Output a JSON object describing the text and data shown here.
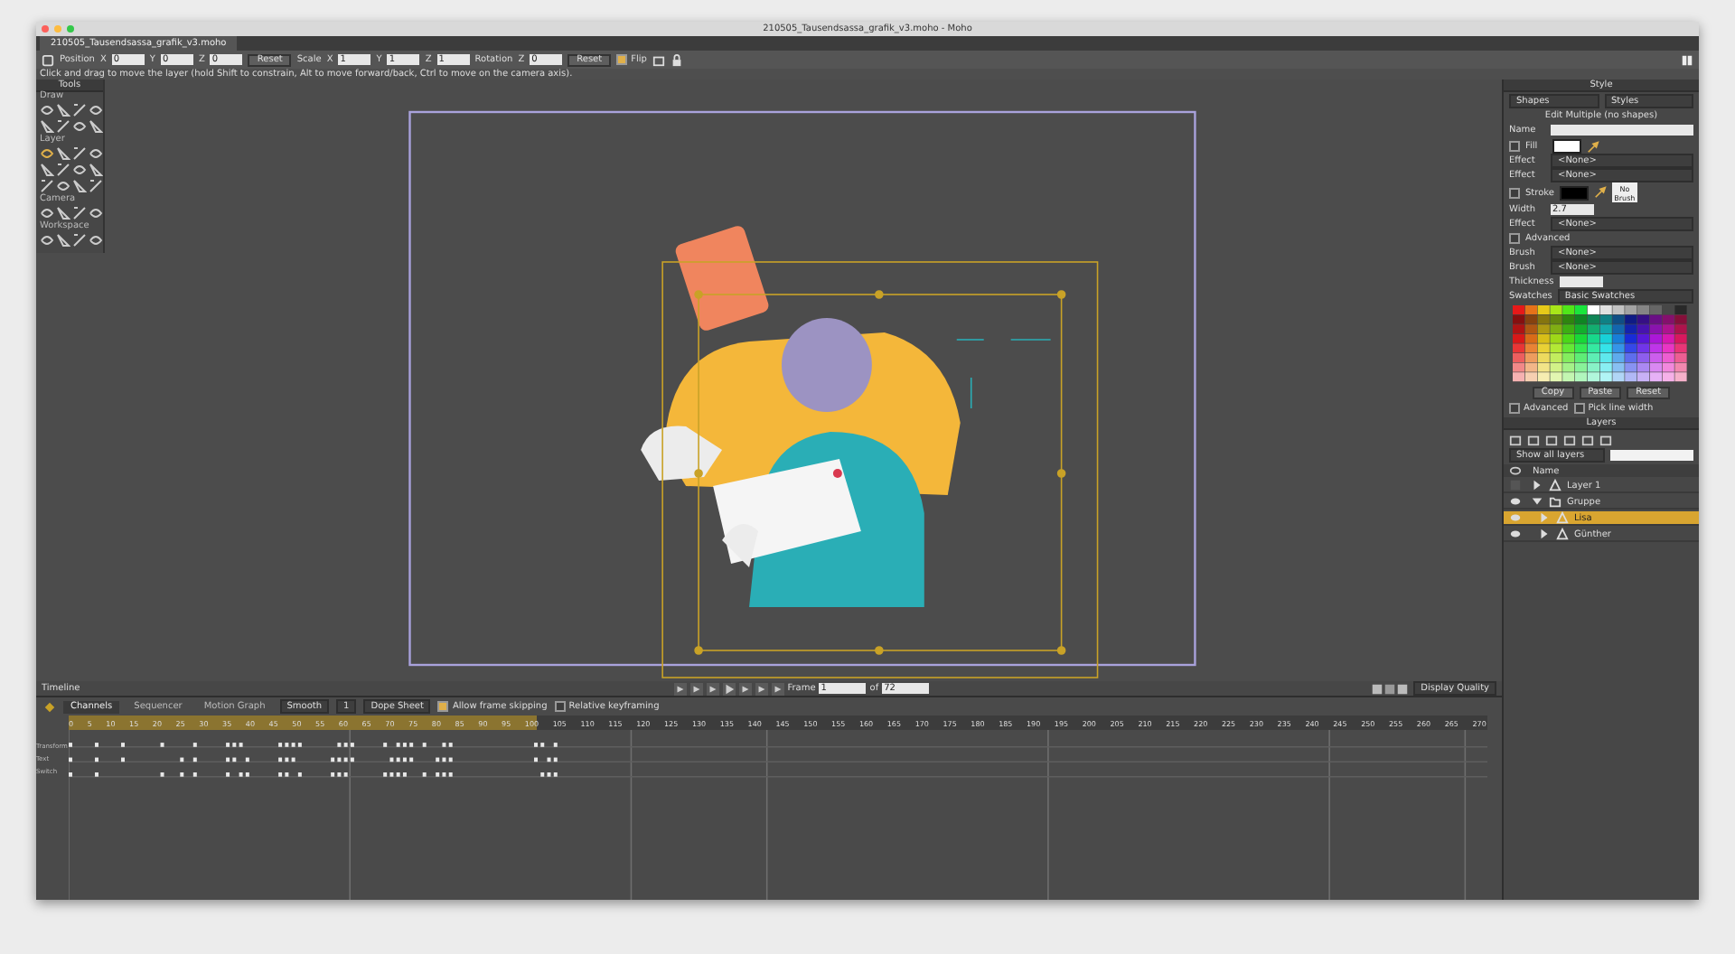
{
  "window": {
    "title": "210505_Tausendsassa_grafik_v3.moho - Moho"
  },
  "document_tab": {
    "label": "210505_Tausendsassa_grafik_v3.moho",
    "selected": true
  },
  "toolbar": [
    {
      "kind": "label",
      "text": "Position"
    },
    {
      "kind": "field",
      "label": "X",
      "value": "0"
    },
    {
      "kind": "field",
      "label": "Y",
      "value": "0"
    },
    {
      "kind": "field",
      "label": "Z",
      "value": "0"
    },
    {
      "kind": "button",
      "text": "Reset"
    },
    {
      "kind": "label",
      "text": "Scale"
    },
    {
      "kind": "field",
      "label": "X",
      "value": "1"
    },
    {
      "kind": "field",
      "label": "Y",
      "value": "1"
    },
    {
      "kind": "field",
      "label": "Z",
      "value": "1"
    },
    {
      "kind": "label",
      "text": "Rotation"
    },
    {
      "kind": "field",
      "label": "Z",
      "value": "0"
    },
    {
      "kind": "button",
      "text": "Reset"
    },
    {
      "kind": "check",
      "text": "Flip",
      "checked": true
    }
  ],
  "status_text": "Click and drag to move the layer (hold Shift to constrain, Alt to move forward/back, Ctrl to move on the camera axis).",
  "tools_panel": {
    "title": "Tools",
    "sections": [
      {
        "title": "Draw"
      },
      {
        "title": "Layer"
      },
      {
        "title": "Camera"
      },
      {
        "title": "Workspace"
      }
    ]
  },
  "canvas_controls": {
    "frame_label": "Frame",
    "frame": "1",
    "of_label": "of",
    "end_frame": "72",
    "quality": "Display Quality"
  },
  "timeline": {
    "title": "Timeline",
    "tabs": [
      {
        "label": "Channels",
        "selected": true
      },
      {
        "label": "Sequencer",
        "selected": false
      },
      {
        "label": "Motion Graph",
        "selected": false
      }
    ],
    "options": [
      {
        "kind": "dropdown",
        "text": "Smooth"
      },
      {
        "kind": "dropdown",
        "text": "1"
      },
      {
        "kind": "dropdown",
        "text": "Dope Sheet"
      },
      {
        "kind": "check",
        "text": "Allow frame skipping",
        "checked": true
      },
      {
        "kind": "check",
        "text": "Relative keyframing",
        "checked": false
      }
    ],
    "ruler": {
      "level": 0.33,
      "labels": [
        "0",
        "5",
        "10",
        "15",
        "20",
        "25",
        "30",
        "35",
        "40",
        "45",
        "50",
        "55",
        "60",
        "65",
        "70",
        "75",
        "80",
        "85",
        "90",
        "95",
        "100",
        "105",
        "110",
        "115",
        "120",
        "125",
        "130",
        "135",
        "140",
        "145",
        "150",
        "155",
        "160",
        "165",
        "170",
        "175",
        "180",
        "185",
        "190",
        "195",
        "200",
        "205",
        "210",
        "215",
        "220",
        "225",
        "230",
        "235",
        "240",
        "245",
        "250",
        "255",
        "260",
        "265",
        "270"
      ]
    },
    "channels": [
      {
        "name": "Transform"
      },
      {
        "name": "Text"
      },
      {
        "name": "Switch"
      }
    ]
  },
  "style_panel": {
    "title": "Style",
    "dropdowns": [
      "Shapes",
      "Styles"
    ],
    "info": "Edit Multiple (no shapes)",
    "name_label": "Name",
    "rows": [
      {
        "kind": "swatch",
        "label": "Fill",
        "checked": false,
        "color": "#ffffff"
      },
      {
        "kind": "select",
        "label": "Effect",
        "value": "<None>"
      },
      {
        "kind": "select",
        "label": "Effect",
        "value": "<None>"
      },
      {
        "kind": "swatch",
        "label": "Stroke",
        "checked": false,
        "color": "#000000"
      },
      {
        "kind": "field",
        "label": "Width",
        "value": "2.7"
      },
      {
        "kind": "select",
        "label": "Effect",
        "value": "<None>"
      },
      {
        "kind": "check",
        "label": "Advanced",
        "checked": false
      },
      {
        "kind": "select",
        "label": "Brush",
        "value": "<None>"
      },
      {
        "kind": "select",
        "label": "Brush",
        "value": "<None>"
      },
      {
        "kind": "field",
        "label": "Thickness",
        "value": ""
      },
      {
        "kind": "select",
        "label": "Swatches",
        "value": "Basic Swatches"
      }
    ],
    "no_brush": "No Brush",
    "buttons": [
      "Copy",
      "Paste",
      "Reset"
    ],
    "checks": [
      {
        "label": "Advanced",
        "checked": false
      },
      {
        "label": "Pick line width",
        "checked": false
      }
    ]
  },
  "layers_panel": {
    "title": "Layers",
    "filter": "Show all layers",
    "columns": [
      "Name"
    ],
    "layers": [
      {
        "name": "Layer 1",
        "kind": "vector",
        "visible": false,
        "selected": false,
        "expanded": false
      },
      {
        "name": "Gruppe",
        "kind": "group",
        "visible": true,
        "selected": false,
        "expanded": true
      },
      {
        "name": "Lisa",
        "kind": "vector",
        "visible": true,
        "selected": true,
        "expanded": false
      },
      {
        "name": "Günther",
        "kind": "vector",
        "visible": true,
        "selected": false,
        "expanded": false
      }
    ]
  }
}
